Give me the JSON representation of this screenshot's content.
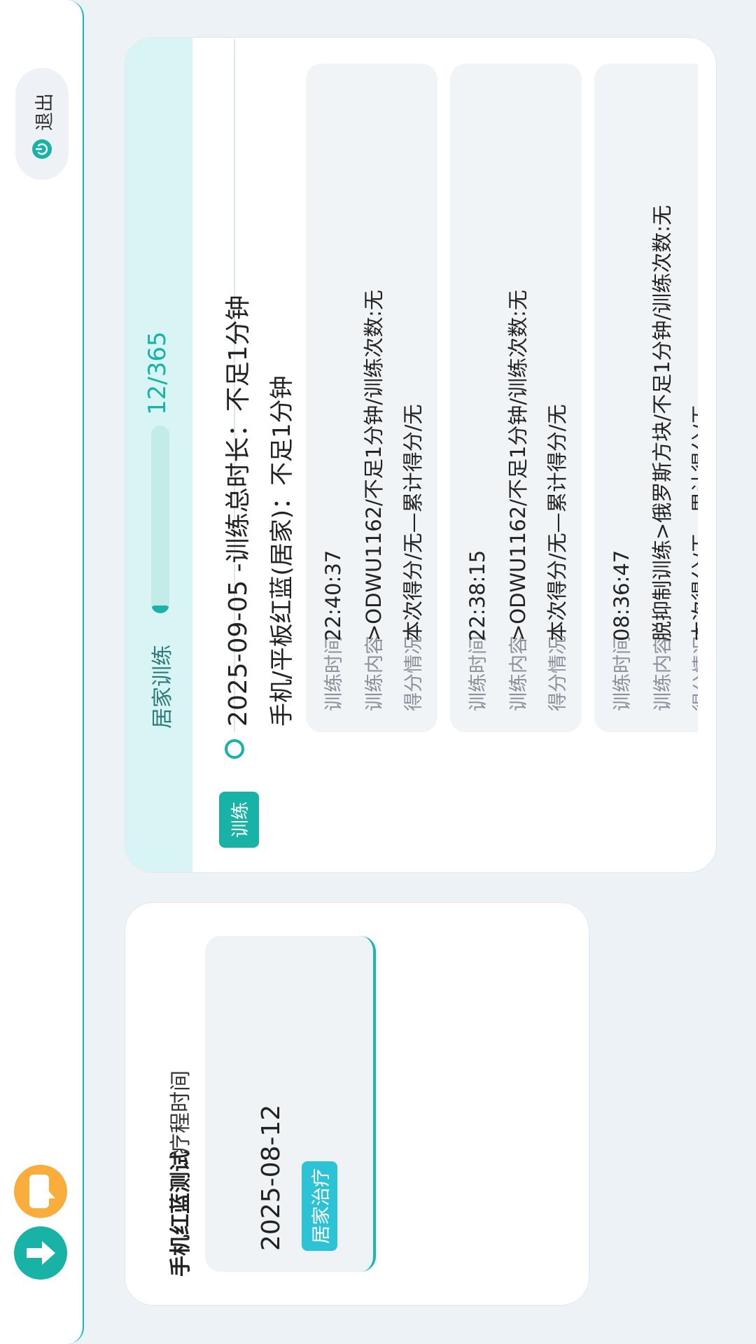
{
  "toolbar": {
    "download_icon": "arrow-down-circle-icon",
    "chat_icon": "chat-bubble-icon",
    "logout_label": "退出",
    "logout_icon": "power-icon"
  },
  "course": {
    "tabs": [
      "手机红蓝测试",
      "疗程时间"
    ],
    "date": "2025-08-12",
    "badge": "居家治疗"
  },
  "panel": {
    "title": "居家训练",
    "progress": {
      "current": 12,
      "total": 365,
      "text": "12/365"
    },
    "tag": "训练",
    "entry_title": "2025-09-05 -训练总时长：不足1分钟",
    "entry_subtitle": "手机/平板红蓝(居家)：不足1分钟",
    "records": [
      {
        "time_label": "训练时间",
        "time": "22:40:37",
        "content_label": "训练内容",
        "content": ">ODWU1162/不足1分钟/训练次数:无",
        "score_label": "得分情况",
        "score": "本次得分/无—累计得分/无"
      },
      {
        "time_label": "训练时间",
        "time": "22:38:15",
        "content_label": "训练内容",
        "content": ">ODWU1162/不足1分钟/训练次数:无",
        "score_label": "得分情况",
        "score": "本次得分/无—累计得分/无"
      },
      {
        "time_label": "训练时间",
        "time": "08:36:47",
        "content_label": "训练内容",
        "content": "脱抑制训练>俄罗斯方块/不足1分钟/训练次数:无",
        "score_label": "得分情况",
        "score": "本次得分/无—累计得分/无"
      }
    ]
  },
  "colors": {
    "accent": "#19b2a6",
    "orange": "#f8ad3d",
    "badge": "#2cc3d6",
    "header_bg": "#d8f4f4"
  }
}
